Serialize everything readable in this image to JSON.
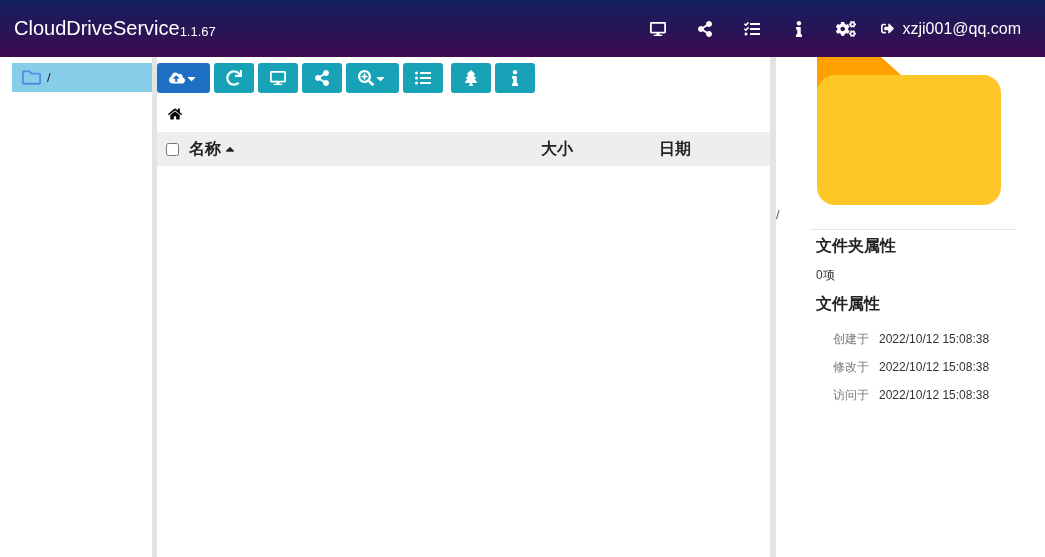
{
  "header": {
    "title": "CloudDriveService",
    "version": "1.1.67",
    "user": "xzji001@qq.com"
  },
  "sidebar": {
    "items": [
      {
        "label": "/",
        "selected": true
      }
    ]
  },
  "toolbar": {
    "buttons": [
      {
        "selected": true,
        "dropdown": true
      },
      {
        "selected": false,
        "dropdown": false
      },
      {
        "selected": false,
        "dropdown": false
      },
      {
        "selected": false,
        "dropdown": false
      },
      {
        "selected": false,
        "dropdown": true
      },
      {
        "selected": false,
        "dropdown": false
      },
      {
        "selected": false,
        "dropdown": false
      },
      {
        "selected": false,
        "dropdown": false
      }
    ]
  },
  "table": {
    "select_all": {
      "checked": false
    },
    "columns": [
      {
        "label": "名称",
        "sorted": true
      },
      {
        "label": "大小",
        "sorted": false
      },
      {
        "label": "日期",
        "sorted": false
      }
    ]
  },
  "details": {
    "path": "/",
    "folder_heading": "文件夹属性",
    "count": "0项",
    "file_heading": "文件属性",
    "properties": [
      {
        "label": "创建于",
        "value": "2022/10/12 15:08:38"
      },
      {
        "label": "修改于",
        "value": "2022/10/12 15:08:38"
      },
      {
        "label": "访问于",
        "value": "2022/10/12 15:08:38"
      }
    ]
  }
}
